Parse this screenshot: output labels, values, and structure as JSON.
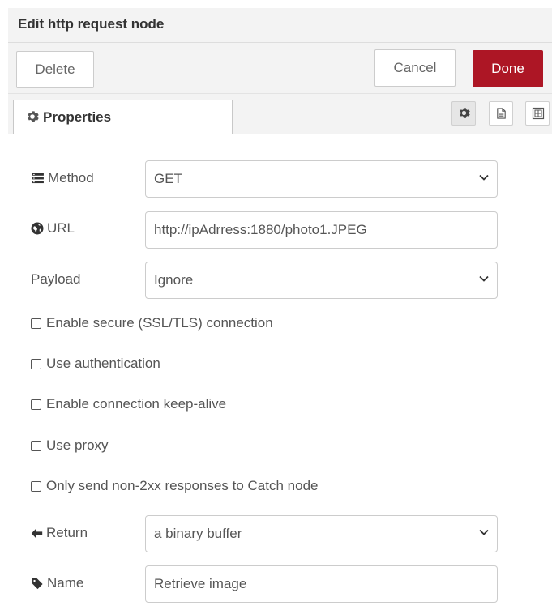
{
  "dialog": {
    "title": "Edit http request node",
    "delete_label": "Delete",
    "cancel_label": "Cancel",
    "done_label": "Done",
    "done_color": "#ad1625"
  },
  "tabs": {
    "properties_label": "Properties",
    "icons": [
      "gear-icon",
      "document-icon",
      "appearance-icon"
    ]
  },
  "form": {
    "method": {
      "label": "Method",
      "value": "GET"
    },
    "url": {
      "label": "URL",
      "value": "http://ipAdrress:1880/photo1.JPEG"
    },
    "payload": {
      "label": "Payload",
      "value": "Ignore"
    },
    "checkboxes": [
      {
        "label": "Enable secure (SSL/TLS) connection",
        "checked": false
      },
      {
        "label": "Use authentication",
        "checked": false
      },
      {
        "label": "Enable connection keep-alive",
        "checked": false
      },
      {
        "label": "Use proxy",
        "checked": false
      },
      {
        "label": "Only send non-2xx responses to Catch node",
        "checked": false
      }
    ],
    "return": {
      "label": "Return",
      "value": "a binary buffer"
    },
    "name": {
      "label": "Name",
      "value": "Retrieve image"
    }
  }
}
